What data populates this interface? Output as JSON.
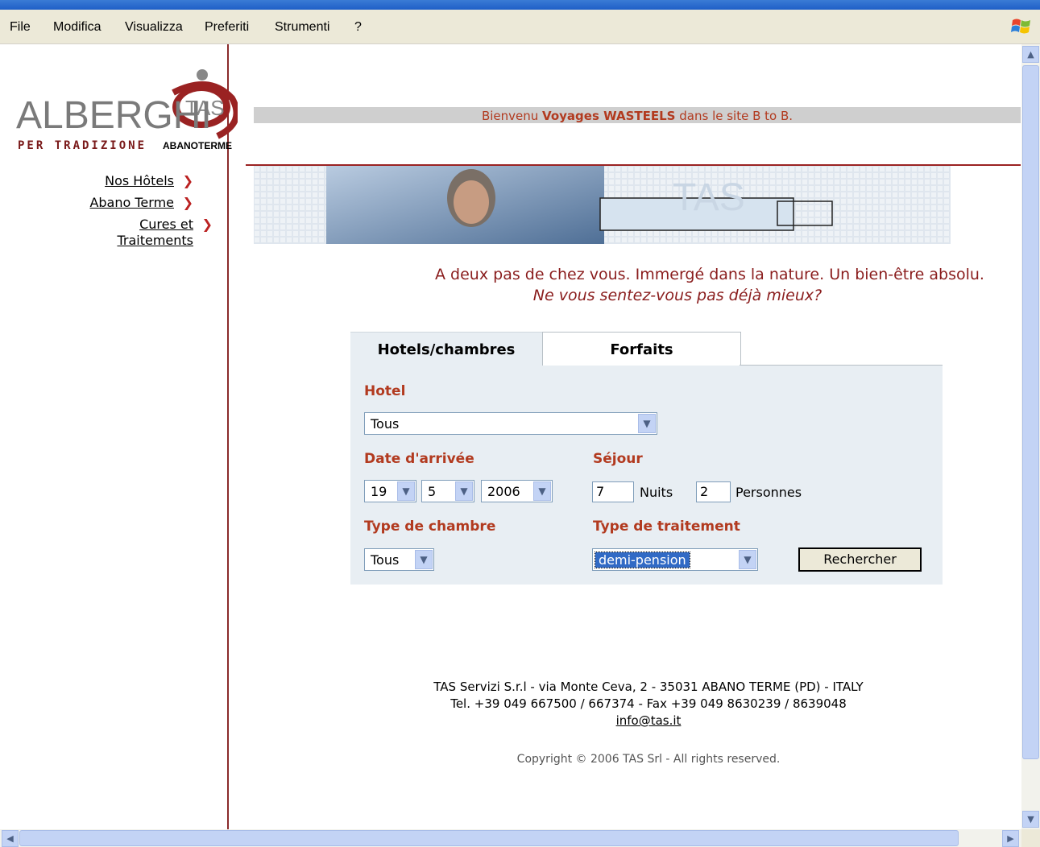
{
  "menu": [
    "File",
    "Modifica",
    "Visualizza",
    "Preferiti",
    "Strumenti",
    "?"
  ],
  "logo": {
    "brand": "ALBERGHI",
    "tag": "TAS",
    "tagline": "PER TRADIZIONE",
    "place": "ABANOTERME"
  },
  "nav": {
    "hotels": "Nos Hôtels",
    "abano": "Abano Terme",
    "cures": "Cures et Traitements"
  },
  "welcome": {
    "prefix": "Bienvenu",
    "name": "Voyages WASTEELS",
    "suffix": "dans le site B to B."
  },
  "slogan": {
    "line1": "A deux pas de chez vous. Immergé dans la nature. Un bien-être absolu.",
    "line2": "Ne vous sentez-vous pas déjà mieux?"
  },
  "tabs": {
    "active": "Hotels/chambres",
    "inactive": "Forfaits"
  },
  "form": {
    "hotel_label": "Hotel",
    "hotel_value": "Tous",
    "date_label": "Date d'arrivée",
    "day": "19",
    "month": "5",
    "year": "2006",
    "stay_label": "Séjour",
    "nights": "7",
    "nights_label": "Nuits",
    "persons": "2",
    "persons_label": "Personnes",
    "room_label": "Type de chambre",
    "room_value": "Tous",
    "treatment_label": "Type de traitement",
    "treatment_value": "demi-pension",
    "search_button": "Rechercher"
  },
  "footer": {
    "line1": "TAS Servizi S.r.l - via Monte Ceva, 2 - 35031 ABANO TERME (PD) - ITALY",
    "line2": "Tel. +39 049 667500 / 667374 - Fax +39 049 8630239 / 8639048",
    "email": "info@tas.it",
    "copyright": "Copyright © 2006 TAS Srl - All rights reserved."
  },
  "colors": {
    "accent": "#b23a1f",
    "panel": "#e8eef3",
    "divider": "#8a2b2b"
  }
}
